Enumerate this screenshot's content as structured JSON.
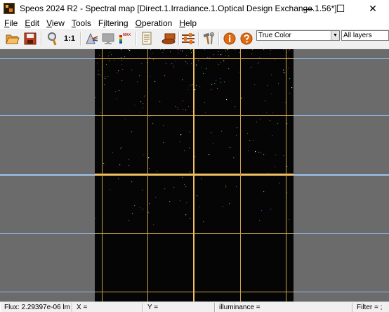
{
  "window": {
    "title": "Speos 2024 R2 - Spectral map [Direct.1.Irradiance.1.Optical Design Exchange.1.56*]",
    "minimize": "—",
    "maximize": "☐",
    "close": "✕"
  },
  "menu": {
    "items": [
      {
        "acc": "F",
        "rest": "ile"
      },
      {
        "acc": "E",
        "rest": "dit"
      },
      {
        "acc": "V",
        "rest": "iew"
      },
      {
        "acc": "T",
        "rest": "ools"
      },
      {
        "pre": "F",
        "acc": "i",
        "rest": "ltering"
      },
      {
        "acc": "O",
        "rest": "peration"
      },
      {
        "acc": "H",
        "rest": "elp"
      }
    ]
  },
  "toolbar": {
    "one_to_one_label": "1:1",
    "color_mode_select": "True Color",
    "layers_select": "All layers",
    "icons": [
      "open-folder-icon",
      "save-icon",
      "zoom-icon",
      "one-to-one-icon",
      "color-prism-icon",
      "monitor-icon",
      "max-color-scale-icon",
      "document-icon",
      "layer-stack-icon",
      "sliders-icon",
      "hammer-wrench-icon",
      "info-icon",
      "help-icon"
    ]
  },
  "status": {
    "flux": "Flux: 2.29397e-06 lm",
    "x": "X =",
    "y": "Y =",
    "quantity": "illuminance =",
    "filter": "Filter = ;"
  }
}
